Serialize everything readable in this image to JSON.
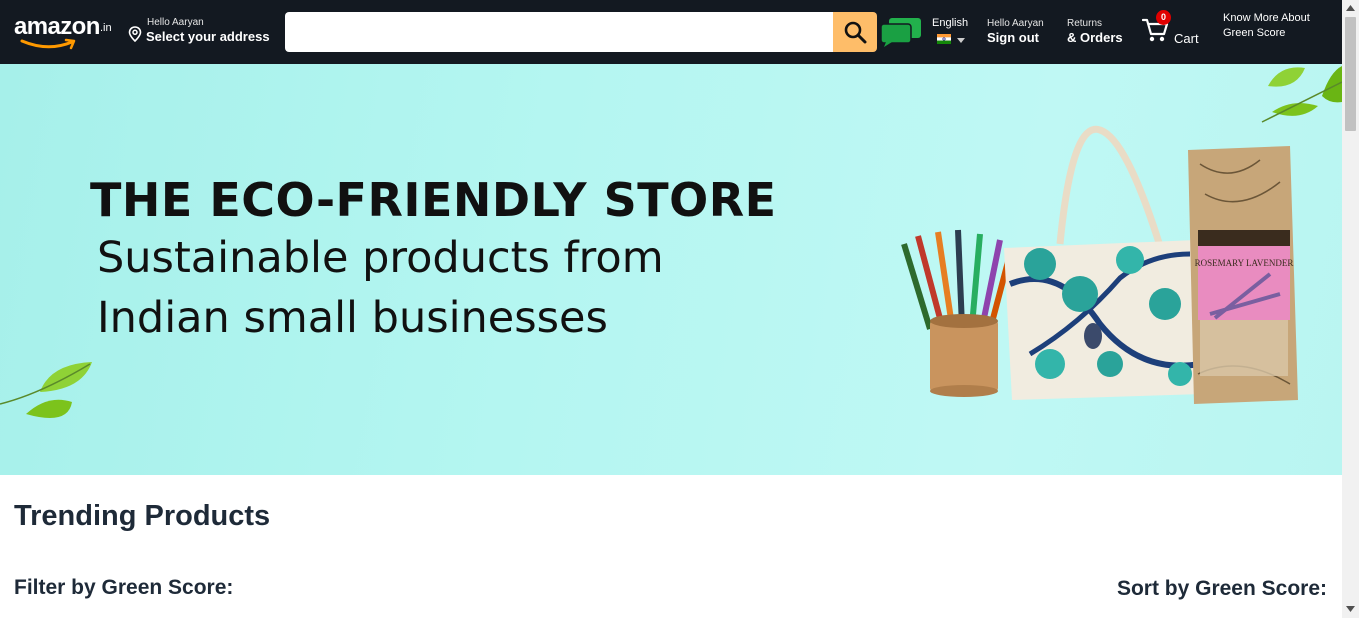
{
  "header": {
    "logo": {
      "text": "amazon",
      "tld": ".in"
    },
    "address": {
      "greeting": "Hello Aaryan",
      "label": "Select your address"
    },
    "search": {
      "value": "",
      "placeholder": ""
    },
    "language": {
      "label": "English"
    },
    "account": {
      "greeting": "Hello Aaryan",
      "label": "Sign out"
    },
    "orders": {
      "line1": "Returns",
      "line2": "& Orders"
    },
    "cart": {
      "count": "0",
      "label": "Cart"
    },
    "green_score": {
      "label": "Know More About Green Score"
    },
    "colors": {
      "navbar": "#131921",
      "search_button": "#febd69",
      "badge": "#e00000",
      "chat_icon": "#22b14c"
    }
  },
  "hero": {
    "title": "THE ECO-FRIENDLY STORE",
    "subtitle_line1": "Sustainable products from",
    "subtitle_line2": "Indian small businesses",
    "product_label": "ROSEMARY LAVENDER",
    "colors": {
      "background": "#b4f6f1",
      "leaf": "#7cc31c"
    }
  },
  "main": {
    "heading": "Trending Products",
    "filter_label": "Filter by Green Score:",
    "sort_label": "Sort by Green Score:"
  }
}
